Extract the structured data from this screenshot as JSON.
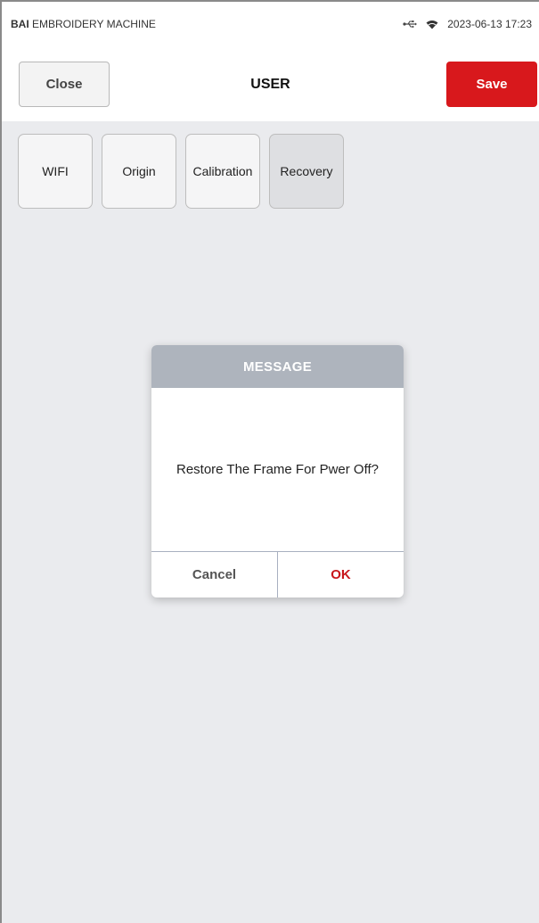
{
  "statusbar": {
    "brand_bold": "BAI",
    "brand_rest": " EMBROIDERY MACHINE",
    "icons": [
      "usb-icon",
      "wifi-icon"
    ],
    "datetime": "2023-06-13 17:23"
  },
  "header": {
    "close_label": "Close",
    "title": "USER",
    "save_label": "Save"
  },
  "tabs": [
    {
      "label": "WIFI",
      "active": false
    },
    {
      "label": "Origin",
      "active": false
    },
    {
      "label": "Calibration",
      "active": false
    },
    {
      "label": "Recovery",
      "active": true
    }
  ],
  "dialog": {
    "title": "MESSAGE",
    "message": "Restore The Frame For Pwer Off?",
    "cancel_label": "Cancel",
    "ok_label": "OK"
  },
  "colors": {
    "accent_red": "#d8181c",
    "dialog_header": "#aeb4bd",
    "background": "#eaebee"
  }
}
